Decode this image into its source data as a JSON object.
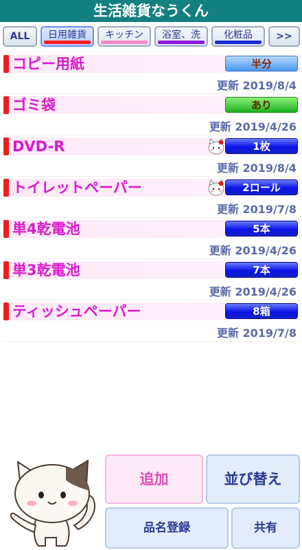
{
  "app": {
    "title": "生活雑貨なうくん"
  },
  "tabs": {
    "all_label": "ALL",
    "more_label": ">>",
    "items": [
      {
        "label": "日用雑貨",
        "color": "#ff1a1a",
        "active": true
      },
      {
        "label": "キッチン",
        "color": "#f58ac8",
        "active": false
      },
      {
        "label": "浴室、洗",
        "color": "#8a19d8",
        "active": false
      },
      {
        "label": "化粧品",
        "color": "#1a2ad8",
        "active": false
      }
    ]
  },
  "items": [
    {
      "name": "コピー用紙",
      "qty": "半分",
      "qty_style": "half",
      "updated": "更新 2019/8/4",
      "has_icon": false
    },
    {
      "name": "ゴミ袋",
      "qty": "あり",
      "qty_style": "green",
      "updated": "更新 2019/4/26",
      "has_icon": false
    },
    {
      "name": "DVD-R",
      "qty": "1枚",
      "qty_style": "blue",
      "updated": "更新 2019/8/4",
      "has_icon": true
    },
    {
      "name": "トイレットペーパー",
      "qty": "2ロール",
      "qty_style": "blue",
      "updated": "更新 2019/7/8",
      "has_icon": true
    },
    {
      "name": "単4乾電池",
      "qty": "5本",
      "qty_style": "blue",
      "updated": "更新 2019/4/26",
      "has_icon": false
    },
    {
      "name": "単3乾電池",
      "qty": "7本",
      "qty_style": "blue",
      "updated": "更新 2019/4/26",
      "has_icon": false
    },
    {
      "name": "ティッシュペーパー",
      "qty": "8箱",
      "qty_style": "blue",
      "updated": "更新 2019/7/8",
      "has_icon": false
    }
  ],
  "actions": {
    "add_label": "追加",
    "sort_label": "並び替え",
    "register_label": "品名登録",
    "share_label": "共有"
  }
}
